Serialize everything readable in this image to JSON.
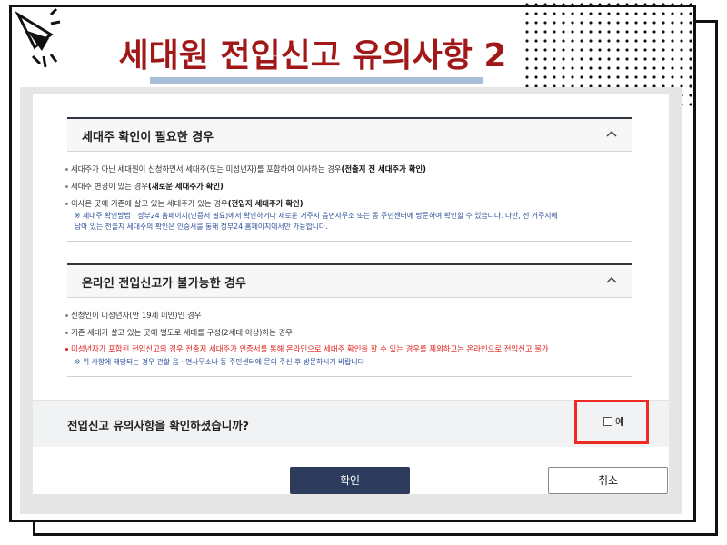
{
  "slide": {
    "title": "세대원 전입신고 유의사항 2"
  },
  "section1": {
    "title": "세대주 확인이 필요한 경우",
    "items": [
      {
        "text": "세대주가 아닌 세대원이 신청하면서 세대주(또는 미성년자)를 포함하여 이사하는 경우",
        "bold": "(전출지 전 세대주가 확인)"
      },
      {
        "text": "세대주 변경이 있는 경우",
        "bold": "(새로운 세대주가 확인)"
      },
      {
        "text": "이사온 곳에 기존에 살고 있는 세대주가 있는 경우",
        "bold": "(전입지 세대주가 확인)"
      }
    ],
    "note_line1": "※ 세대주 확인방법 : 정부24 홈페이지(인증서 필요)에서 확인하거나 새로운 거주지 읍면사무소 또는 동 주민센터에 방문하여 확인할 수 있습니다. 다만, 전 거주지에",
    "note_line2": "남아 있는 전출지 세대주의 확인은 인증서를 통해 정부24 홈페이지에서만 가능합니다."
  },
  "section2": {
    "title": "온라인 전입신고가 불가능한 경우",
    "items": [
      "신청인이 미성년자(만 19세 미만)인 경우",
      "기존 세대가 살고 있는 곳에 별도로 세대를 구성(2세대 이상)하는 경우"
    ],
    "red_item": "미성년자가 포함된 전입신고의 경우 전출지 세대주가 인증서를 통해 온라인으로 세대주 확인을 할 수 있는 경우를 제외하고는 온라인으로 전입신고 불가",
    "note": "※ 위 사항에 해당되는 경우 관할 읍 · 면사무소나 동 주민센터에 문의 주신 후 방문하시기 바랍니다"
  },
  "confirm": {
    "question": "전입신고 유의사항을 확인하셨습니까?",
    "checkbox_label": "예"
  },
  "buttons": {
    "ok": "확인",
    "cancel": "취소"
  },
  "colors": {
    "title": "#a01818",
    "highlight": "#ec2b24",
    "primary_button": "#2d3b5c",
    "note": "#2b4f9a",
    "warning": "#e0201e"
  }
}
